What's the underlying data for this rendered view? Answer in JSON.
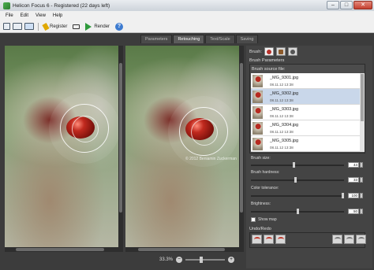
{
  "window": {
    "title": "Helicon Focus 6 - Registered (22 days left)",
    "min": "–",
    "max": "□",
    "close": "✕"
  },
  "menu": [
    "File",
    "Edit",
    "View",
    "Help"
  ],
  "toolbar": {
    "register": "Register",
    "render": "Render",
    "help": "?"
  },
  "tabs": [
    "Parameters",
    "Retouching",
    "Text/Scale",
    "Saving"
  ],
  "active_tab": "Retouching",
  "viewer": {
    "watermark": "© 2012 Beniamin Zuckerman",
    "zoom": "33.3%",
    "zoom_out": "−",
    "zoom_in": "+"
  },
  "panel": {
    "brush_label": "Brush:",
    "params_title": "Brush Parameters",
    "source_title": "Brush source file:",
    "files": [
      {
        "name": "_MG_9301.jpg",
        "date": "08.11.12 13:38"
      },
      {
        "name": "_MG_9302.jpg",
        "date": "08.11.12 13:38"
      },
      {
        "name": "_MG_9303.jpg",
        "date": "08.11.12 13:38"
      },
      {
        "name": "_MG_9304.jpg",
        "date": "08.11.12 13:38"
      },
      {
        "name": "_MG_9305.jpg",
        "date": "08.11.12 13:38"
      }
    ],
    "selected_file": 1,
    "brush_size_label": "Brush size:",
    "brush_size": "44",
    "brush_size_level": 0.46,
    "brush_hardness_label": "Brush hardness:",
    "brush_hardness": "33",
    "brush_hardness_level": 0.48,
    "color_tolerance_label": "Color tolerance:",
    "color_tolerance": "100",
    "color_tolerance_level": 1.0,
    "brightness_label": "Brightness:",
    "brightness": "50",
    "brightness_level": 0.5,
    "show_map": "Show map",
    "undo_title": "Undo/Redo"
  }
}
